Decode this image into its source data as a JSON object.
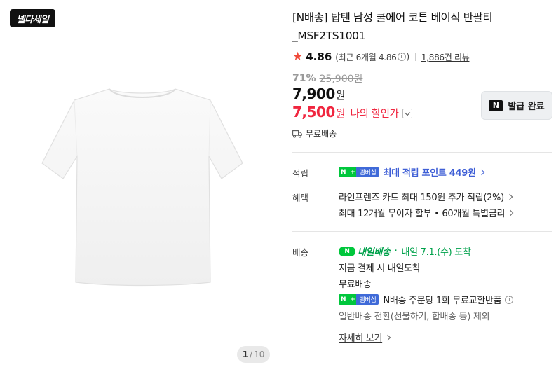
{
  "gallery": {
    "sale_badge": "넬다세일",
    "page_current": "1",
    "page_sep": "/",
    "page_total": "10"
  },
  "product": {
    "title": "[N배송] 탑텐 남성 쿨에어 코튼 베이직 반팔티 _MSF2TS1001",
    "rating": "4.86",
    "rating_recent": "(최근 6개월 4.86",
    "rating_recent_close": ")",
    "review_count": "1,886건 리뷰",
    "discount_rate": "71%",
    "original_price": "25,900원",
    "price": "7,900",
    "price_unit": "원",
    "my_price": "7,500",
    "my_price_unit": "원",
    "my_price_label": "나의 할인가",
    "coupon_button": "발급 완료",
    "coupon_mark": "N",
    "shipping_fee": "무료배송"
  },
  "benefits": {
    "points_label": "적립",
    "member_badge": [
      "N",
      "+",
      "멤버십"
    ],
    "points_text": "최대 적립 포인트 449원",
    "perks_label": "혜택",
    "perk_1": "라인프렌즈 카드 최대 150원 추가 적립(2%)",
    "perk_2": "최대 12개월 무이자 할부 • 60개월 특별금리"
  },
  "delivery": {
    "label": "배송",
    "tomorrow_badge": "N",
    "tomorrow_text": "내일배송",
    "dot": "·",
    "arrival": "내일 7.1.(수) 도착",
    "line_1": "지금 결제 시 내일도착",
    "line_2": "무료배송",
    "exchange_text": "N배송 주문당 1회 무료교환반품",
    "line_4": "일반배송 전환(선물하기, 합배송 등) 제외",
    "detail_link": "자세히 보기"
  },
  "colors": {
    "accent_red": "#f0263f",
    "naver_green": "#00c73c",
    "point_blue": "#3f5fd6",
    "star": "#f04a3a"
  }
}
